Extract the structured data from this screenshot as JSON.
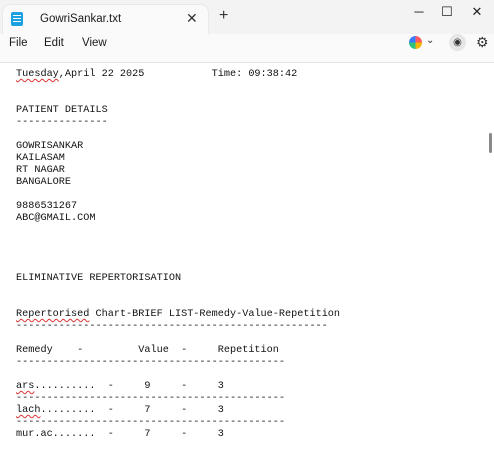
{
  "window": {
    "tab_title": "GowriSankar.txt",
    "icons": [
      "notepad-icon",
      "close-icon",
      "plus-icon",
      "minimize-icon",
      "maximize-icon",
      "close-icon"
    ]
  },
  "menu": {
    "items": [
      "File",
      "Edit",
      "View"
    ],
    "right_icons": [
      "copilot-icon",
      "chevron-down-icon",
      "account-icon",
      "gear-icon"
    ]
  },
  "document": {
    "lines": [
      {
        "parts": [
          {
            "text": "Tuesday",
            "spell": true
          },
          {
            "text": ",April 22 2025           Time: 09:38:42",
            "spell": false
          }
        ]
      },
      {
        "parts": []
      },
      {
        "parts": []
      },
      {
        "parts": [
          {
            "text": "PATIENT DETAILS",
            "spell": false
          }
        ]
      },
      {
        "parts": [
          {
            "text": "---------------",
            "spell": false
          }
        ]
      },
      {
        "parts": []
      },
      {
        "parts": [
          {
            "text": "GOWRISANKAR",
            "spell": false
          }
        ]
      },
      {
        "parts": [
          {
            "text": "KAILASAM",
            "spell": false
          }
        ]
      },
      {
        "parts": [
          {
            "text": "RT NAGAR",
            "spell": false
          }
        ]
      },
      {
        "parts": [
          {
            "text": "BANGALORE",
            "spell": false
          }
        ]
      },
      {
        "parts": []
      },
      {
        "parts": [
          {
            "text": "9886531267",
            "spell": false
          }
        ]
      },
      {
        "parts": [
          {
            "text": "ABC@GMAIL.COM",
            "spell": false
          }
        ]
      },
      {
        "parts": []
      },
      {
        "parts": []
      },
      {
        "parts": []
      },
      {
        "parts": []
      },
      {
        "parts": [
          {
            "text": "ELIMINATIVE REPERTORISATION",
            "spell": false
          }
        ]
      },
      {
        "parts": []
      },
      {
        "parts": []
      },
      {
        "parts": [
          {
            "text": "Repertorised",
            "spell": true
          },
          {
            "text": " Chart-BRIEF LIST-Remedy-Value-Repetition",
            "spell": false
          }
        ]
      },
      {
        "parts": [
          {
            "text": "---------------------------------------------------",
            "spell": false
          }
        ]
      },
      {
        "parts": []
      },
      {
        "parts": [
          {
            "text": "Remedy    -         Value  -     Repetition",
            "spell": false
          }
        ]
      },
      {
        "parts": [
          {
            "text": "--------------------------------------------",
            "spell": false
          }
        ]
      },
      {
        "parts": []
      },
      {
        "parts": [
          {
            "text": "ars",
            "spell": true
          },
          {
            "text": "..........  -     9     -     3",
            "spell": false
          }
        ]
      },
      {
        "parts": [
          {
            "text": "--------------------------------------------",
            "spell": false
          }
        ]
      },
      {
        "parts": [
          {
            "text": "lach",
            "spell": true
          },
          {
            "text": ".........  -     7     -     3",
            "spell": false
          }
        ]
      },
      {
        "parts": [
          {
            "text": "--------------------------------------------",
            "spell": false
          }
        ]
      },
      {
        "parts": [
          {
            "text": "mur.ac.......  -     7     -     3",
            "spell": false
          }
        ]
      }
    ]
  },
  "colors": {
    "titlebar_bg": "#f3f3f3",
    "editor_bg": "#ffffff",
    "text": "#111111",
    "spellcheck": "#dd3333"
  }
}
